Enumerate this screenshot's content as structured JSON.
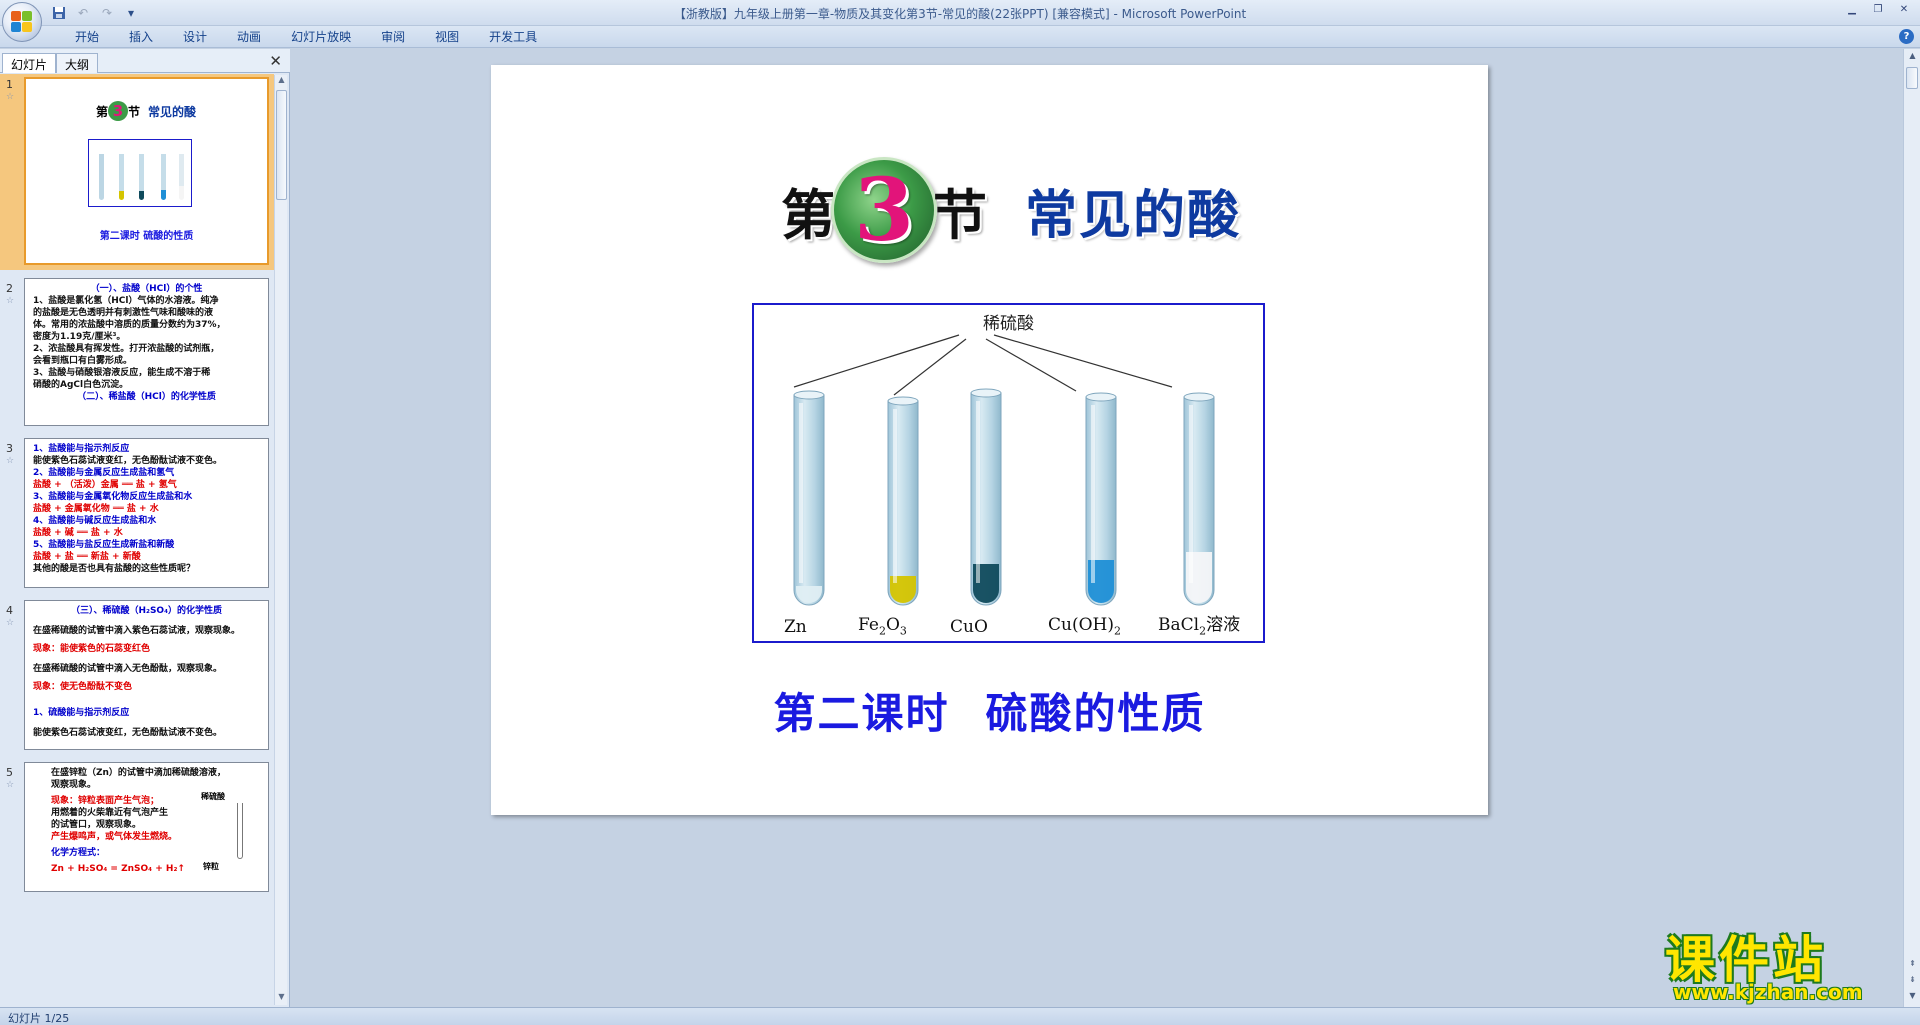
{
  "window": {
    "title": "【浙教版】九年级上册第一章-物质及其变化第3节-常见的酸(22张PPT) [兼容模式] - Microsoft PowerPoint"
  },
  "ribbon": {
    "tabs": [
      "开始",
      "插入",
      "设计",
      "动画",
      "幻灯片放映",
      "审阅",
      "视图",
      "开发工具"
    ]
  },
  "pane": {
    "tabs": [
      "幻灯片",
      "大纲"
    ]
  },
  "thumbnails": [
    {
      "num": "1",
      "title_a": "第",
      "title_num": "3",
      "title_b": "节",
      "title_c": "常见的酸",
      "subtitle": "第二课时   硫酸的性质"
    },
    {
      "num": "2",
      "lines": [
        "（一）、盐酸（HCl）的个性",
        "1、盐酸是氯化氢（HCl）气体的水溶液。纯净",
        "的盐酸是无色透明并有刺激性气味和酸味的液",
        "体。常用的浓盐酸中溶质的质量分数约为37%，",
        "密度为1.19克/厘米³。",
        "2、浓盐酸具有挥发性。打开浓盐酸的试剂瓶，",
        "会看到瓶口有白雾形成。",
        "3、盐酸与硝酸银溶液反应，能生成不溶于稀",
        "硝酸的AgCl白色沉淀。",
        "（二）、稀盐酸（HCl）的化学性质"
      ]
    },
    {
      "num": "3",
      "lines": [
        "1、盐酸能与指示剂反应",
        "能使紫色石蕊试液变红，无色酚酞试液不变色。",
        "2、盐酸能与金属反应生成盐和氢气",
        "盐酸 + （活泼）金属 ══ 盐 + 氢气",
        "3、盐酸能与金属氧化物反应生成盐和水",
        "盐酸 + 金属氧化物 ══ 盐 + 水",
        "4、盐酸能与碱反应生成盐和水",
        "盐酸 + 碱 ══ 盐 + 水",
        "5、盐酸能与盐反应生成新盐和新酸",
        "盐酸 + 盐 ══ 新盐 + 新酸",
        "其他的酸是否也具有盐酸的这些性质呢？"
      ]
    },
    {
      "num": "4",
      "lines": [
        "（三）、稀硫酸（H₂SO₄）的化学性质",
        "在盛稀硫酸的试管中滴入紫色石蕊试液，观察现象。",
        "现象：能使紫色的石蕊变红色",
        "在盛稀硫酸的试管中滴入无色酚酞，观察现象。",
        "现象：使无色酚酞不变色",
        "1、硫酸能与指示剂反应",
        "能使紫色石蕊试液变红，无色酚酞试液不变色。"
      ]
    },
    {
      "num": "5",
      "lines": [
        "在盛锌粒（Zn）的试管中滴加稀硫酸溶液，",
        "观察现象。",
        "现象：锌粒表面产生气泡；",
        "用燃着的火柴靠近有气泡产生",
        "的试管口，观察现象。",
        "产生爆鸣声，或气体发生燃烧。",
        "化学方程式：",
        "Zn + H₂SO₄ = ZnSO₄ + H₂↑"
      ],
      "label_dilute": "稀硫酸",
      "label_zinc": "锌粒"
    }
  ],
  "slide": {
    "title_a": "第",
    "title_num": "3",
    "title_b": "节",
    "title_c": "常见的酸",
    "figure_top_label": "稀硫酸",
    "tubes": [
      {
        "label": "Zn",
        "liquid": "#dfeef3"
      },
      {
        "label": "Fe2O3",
        "liquid": "#d4c400"
      },
      {
        "label": "CuO",
        "liquid": "#0f4a5c"
      },
      {
        "label": "Cu(OH)2",
        "liquid": "#1f8fd6"
      },
      {
        "label": "BaCl2溶液",
        "liquid": "#f4f6f8"
      }
    ],
    "subtitle_a": "第二课时",
    "subtitle_b": "硫酸的性质"
  },
  "watermark": {
    "text": "课件站",
    "url": "www.kjzhan.com"
  },
  "status": {
    "text": "幻灯片 1/25"
  },
  "colors": {
    "title_blue": "#0e3aa0",
    "subtitle_blue": "#1a1ae0",
    "badge_pink": "#e2147a",
    "selected_thumb": "#f5c77e"
  }
}
